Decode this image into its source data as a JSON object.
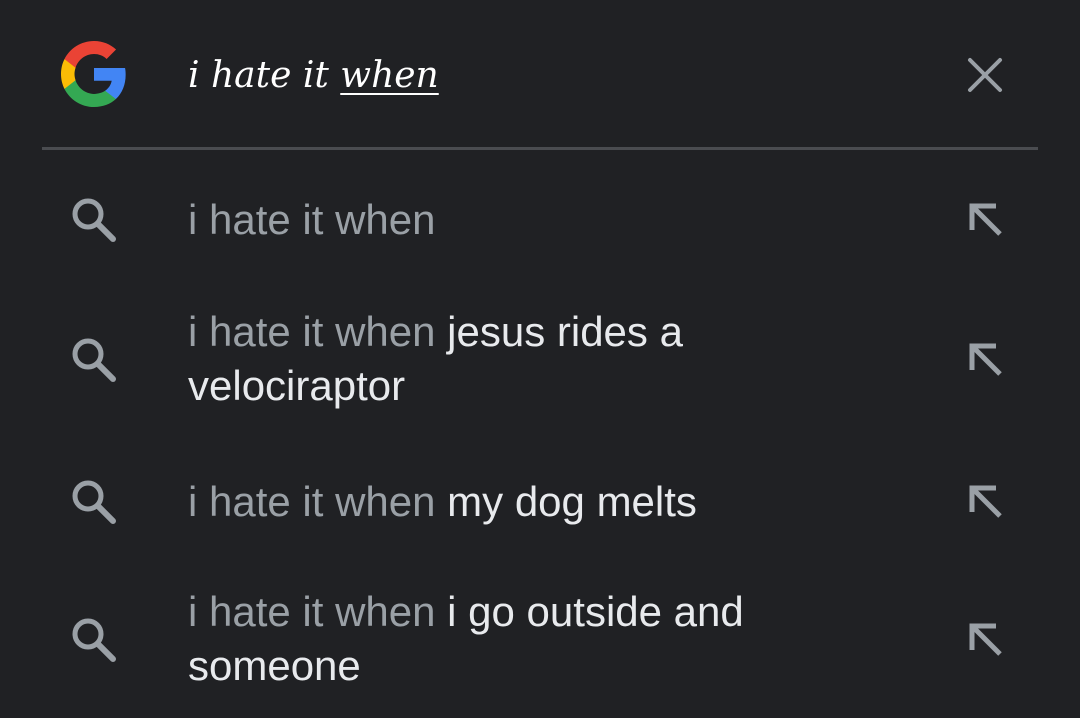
{
  "search_bar": {
    "logo_icon": "google-g-icon",
    "query_plain": "i hate it ",
    "query_typed": "when",
    "clear_icon": "close-icon"
  },
  "colors": {
    "background": "#202124",
    "divider": "#4a4c50",
    "prefix_text": "#9aa0a6",
    "completion_text": "#e8eaed",
    "icon": "#9aa0a6",
    "google_blue": "#4285F4",
    "google_red": "#EA4335",
    "google_yellow": "#FBBC05",
    "google_green": "#34A853"
  },
  "suggestions": [
    {
      "prefix": "i hate it when",
      "rest": "",
      "search_icon": "search-icon",
      "fill_icon": "arrow-up-left-icon"
    },
    {
      "prefix": "i hate it when",
      "rest": " jesus rides a velociraptor",
      "search_icon": "search-icon",
      "fill_icon": "arrow-up-left-icon"
    },
    {
      "prefix": "i hate it when",
      "rest": " my dog melts",
      "search_icon": "search-icon",
      "fill_icon": "arrow-up-left-icon"
    },
    {
      "prefix": "i hate it when",
      "rest": " i go outside and someone",
      "search_icon": "search-icon",
      "fill_icon": "arrow-up-left-icon"
    }
  ]
}
